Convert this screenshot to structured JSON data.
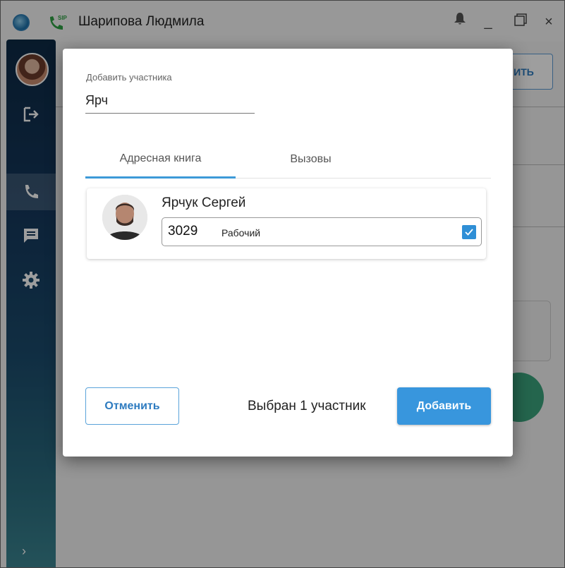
{
  "window": {
    "title": "Шарипова Людмила",
    "controls": {
      "minimize": "_",
      "close": "×"
    }
  },
  "background": {
    "partial_button_label": "ИТЬ"
  },
  "dialog": {
    "field_label": "Добавить участника",
    "field_value": "Ярч",
    "tabs": [
      {
        "label": "Адресная книга",
        "active": true
      },
      {
        "label": "Вызовы",
        "active": false
      }
    ],
    "contacts": [
      {
        "name": "Ярчук Сергей",
        "number": "3029",
        "type": "Рабочий",
        "checked": true
      }
    ],
    "cancel_label": "Отменить",
    "selected_text": "Выбран 1 участник",
    "add_label": "Добавить"
  },
  "sidebar": {
    "items": [
      "avatar",
      "logout-icon",
      "phone-icon",
      "chat-icon",
      "settings-icon"
    ],
    "expand_label": "›"
  },
  "colors": {
    "accent": "#3896dd",
    "sidebar_dark": "#0e2a45",
    "checkbox": "#2f8fd6"
  }
}
